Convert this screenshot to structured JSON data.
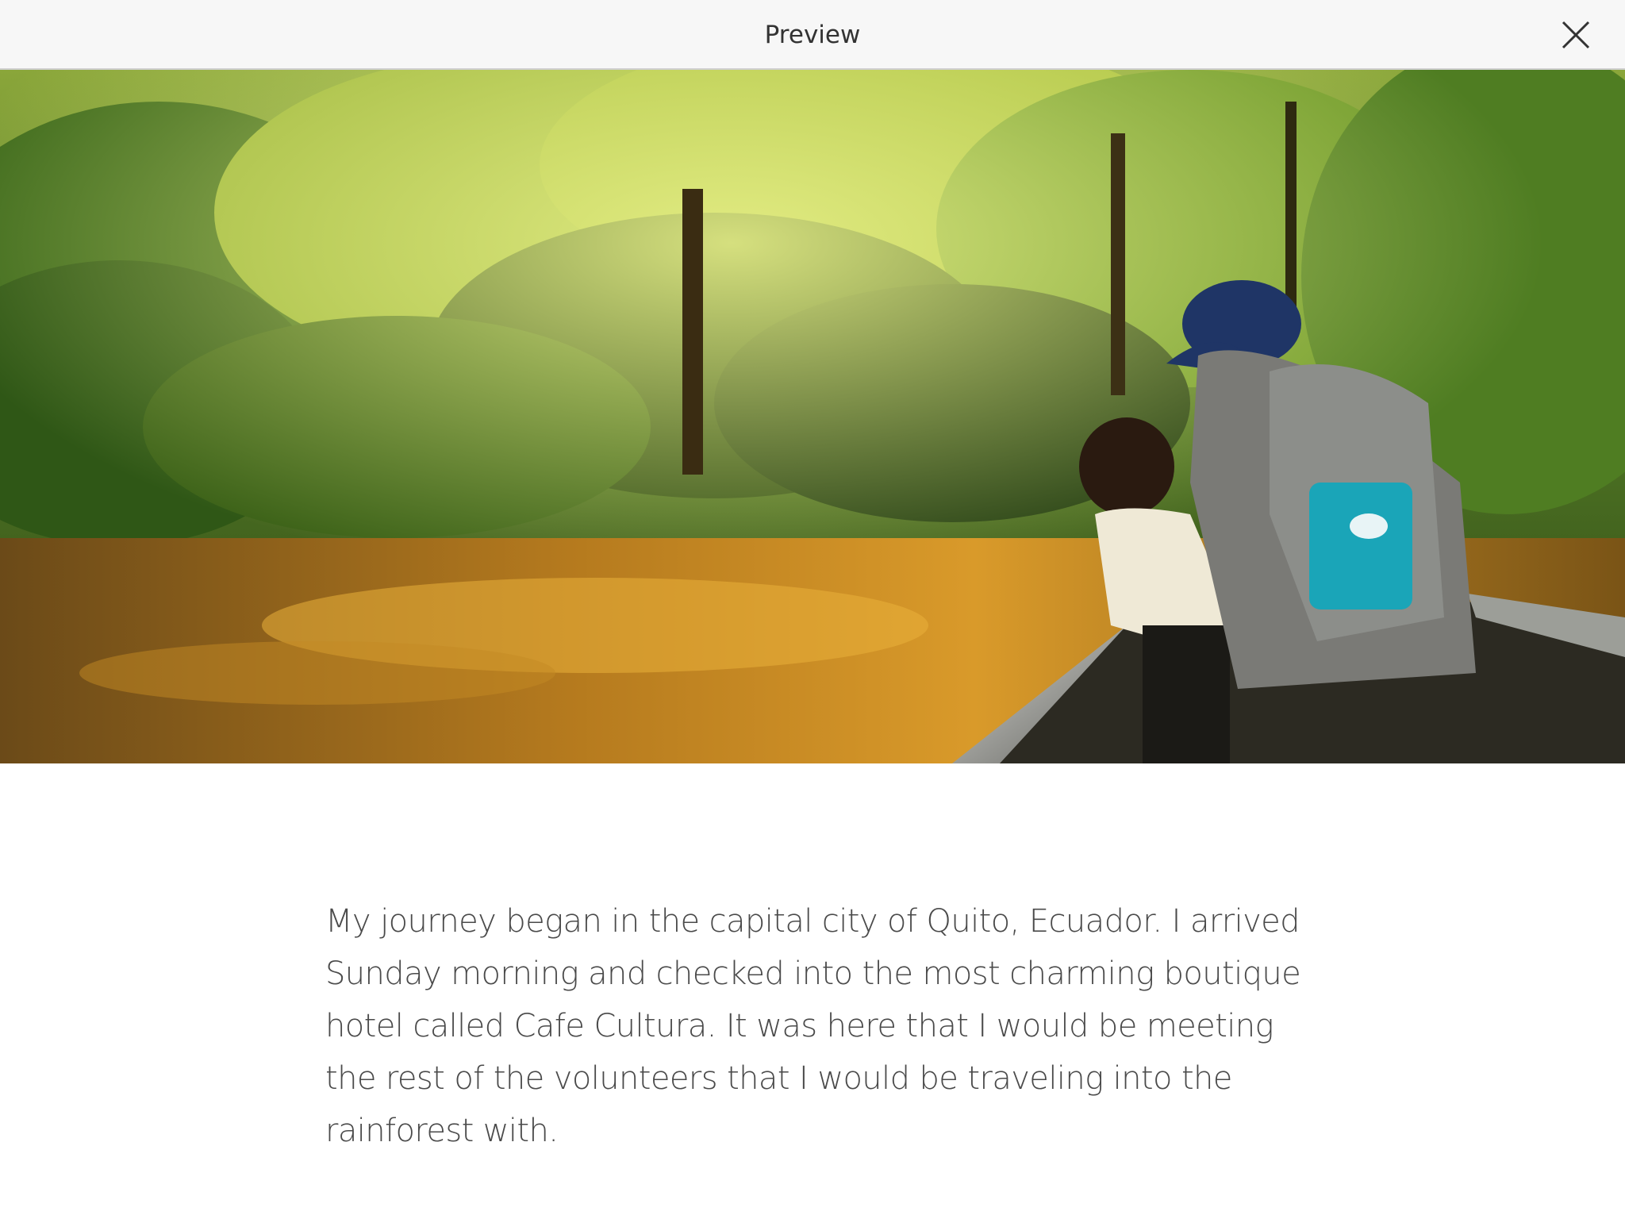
{
  "header": {
    "title": "Preview",
    "close_icon": "close-icon"
  },
  "hero": {
    "icon": "photo-rainforest-canoe"
  },
  "article": {
    "paragraph": "My journey began in the capital city of Quito, Ecuador. I arrived Sunday morning and checked into the most charming boutique hotel called Cafe Cultura. It was here that I would be meeting the rest of the volunteers that I would be traveling into the rainforest with."
  },
  "colors": {
    "topbar_bg": "#f7f7f7",
    "text": "#4a4a4a",
    "title": "#333333"
  }
}
